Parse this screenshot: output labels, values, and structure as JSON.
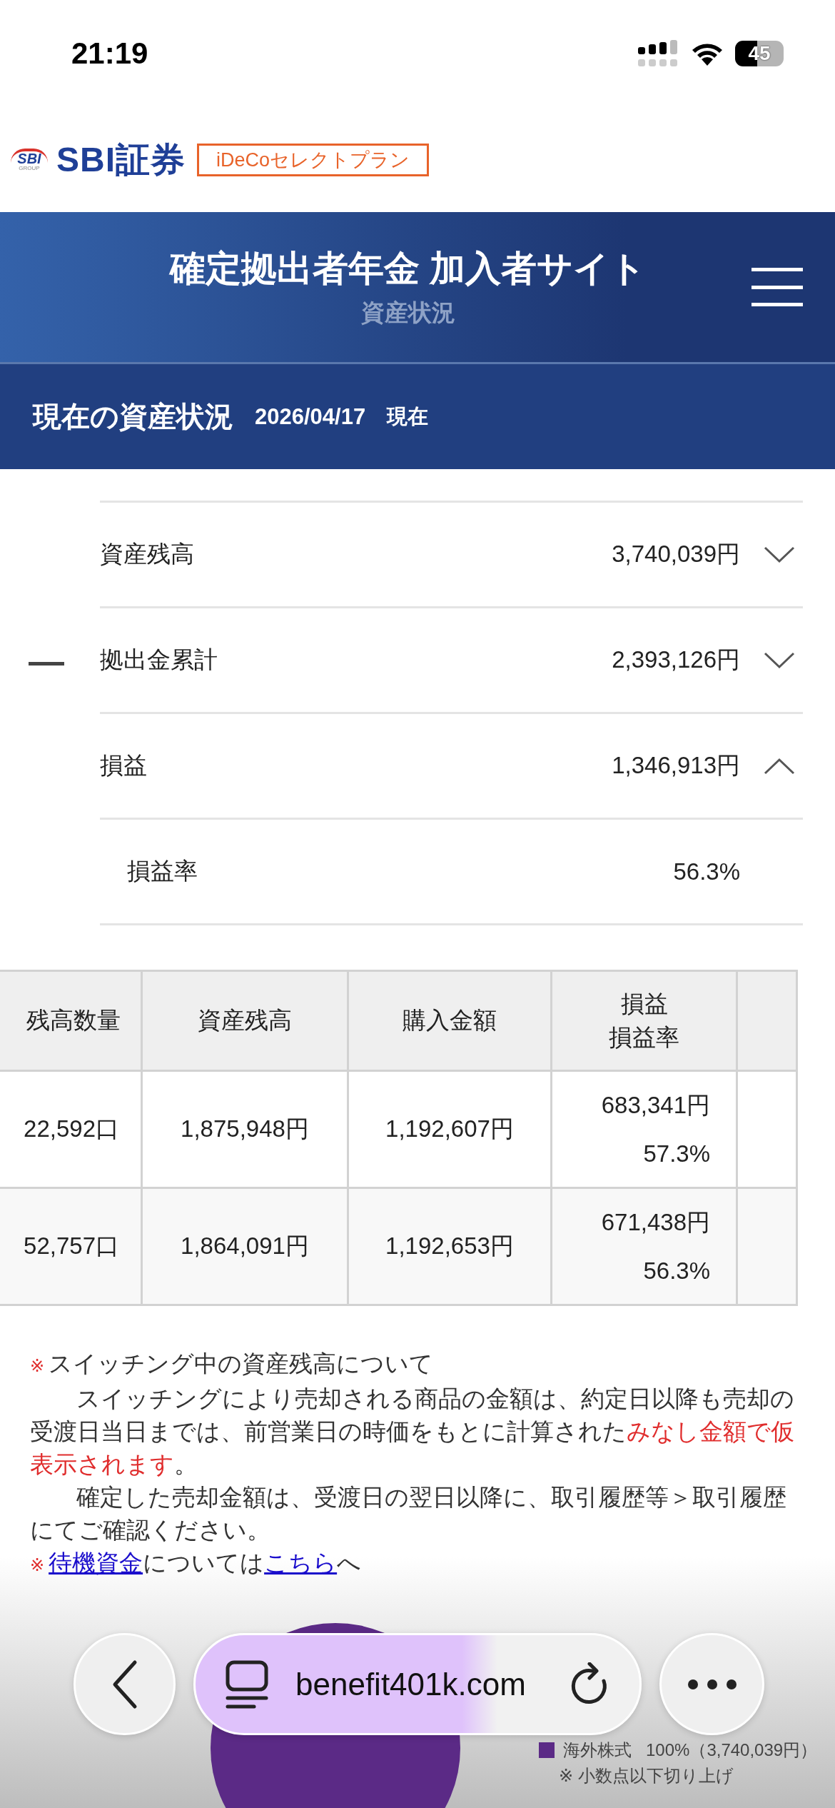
{
  "status_bar": {
    "time": "21:19",
    "battery": "45"
  },
  "brand": {
    "emblem": "SBI",
    "emblem_sub": "GROUP",
    "logo": "SBI証券",
    "plan": "iDeCoセレクトプラン"
  },
  "header": {
    "title": "確定拠出者年金 加入者サイト",
    "subtitle": "資産状況"
  },
  "section": {
    "title": "現在の資産状況",
    "date": "2026/04/17",
    "suffix": "現在"
  },
  "summary": [
    {
      "kind": "total",
      "label": "資産残高",
      "value": "3,740,039円",
      "expanded": false
    },
    {
      "kind": "total",
      "sign": "—",
      "label": "拠出金累計",
      "value": "2,393,126円",
      "expanded": false
    },
    {
      "kind": "total",
      "label": "損益",
      "value": "1,346,913円",
      "expanded": true
    },
    {
      "kind": "detail",
      "label": "損益率",
      "value": "56.3%"
    }
  ],
  "table": {
    "columns": [
      {
        "label": "残高数量"
      },
      {
        "label": "資産残高"
      },
      {
        "label": "購入金額"
      },
      {
        "label": "損益",
        "sublabel": "損益率"
      }
    ],
    "rows": [
      {
        "cells": [
          "22,592口",
          "1,875,948円",
          "1,192,607円"
        ],
        "gain": "683,341円",
        "rate": "57.3%"
      },
      {
        "cells": [
          "52,757口",
          "1,864,091円",
          "1,192,653円"
        ],
        "gain": "671,438円",
        "rate": "56.3%"
      }
    ]
  },
  "notes": [
    {
      "kind": "heading",
      "mark": "※",
      "segments": [
        {
          "text": "スイッチング中の資産残高について"
        }
      ]
    },
    {
      "kind": "para",
      "segments": [
        {
          "text": "スイッチングにより売却される商品の金額は、約定日以降も売却の受渡日当日までは、前営業日の時価をもとに計算された"
        },
        {
          "text": "みなし金額で仮表示されます",
          "emphasis": true
        },
        {
          "text": "。"
        }
      ]
    },
    {
      "kind": "para",
      "segments": [
        {
          "text": "確定した売却金額は、受渡日の翌日以降に、取引履歴等＞取引履歴にてご確認ください。"
        }
      ]
    },
    {
      "kind": "heading",
      "mark": "※",
      "segments": [
        {
          "text": "待機資金",
          "link": true
        },
        {
          "text": "については"
        },
        {
          "text": "こちら",
          "link": true
        },
        {
          "text": "へ"
        }
      ]
    }
  ],
  "allocation": {
    "legend": [
      {
        "label": "海外株式",
        "value": "100%（3,740,039円）",
        "color": "#5b2a86"
      }
    ],
    "footnote": "※ 小数点以下切り上げ"
  },
  "browser": {
    "url": "benefit401k.com"
  }
}
